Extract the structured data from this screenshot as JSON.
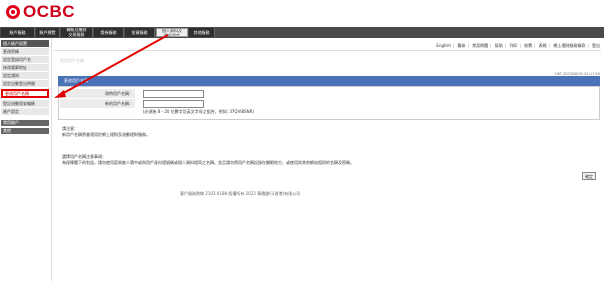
{
  "brand": {
    "name": "OCBC",
    "color": "#e3001b"
  },
  "topnav": {
    "tabs": [
      {
        "label": "賬戶服務",
        "lines": 1
      },
      {
        "label": "賬戶總覽",
        "lines": 1
      },
      {
        "label": "轉賬及繳款\n交易服務",
        "lines": 2
      },
      {
        "label": "證券服務",
        "lines": 1
      },
      {
        "label": "投資服務",
        "lines": 1
      },
      {
        "label": "個人資料及\n賬戶設定",
        "lines": 2,
        "active": true
      },
      {
        "label": "其他服務",
        "lines": 1
      }
    ]
  },
  "sidebar": {
    "items": [
      {
        "label": "個人賬戶設置",
        "style": "head"
      },
      {
        "label": "更改密碼",
        "style": "normal"
      },
      {
        "label": "設定登錄用戶名",
        "style": "normal"
      },
      {
        "label": "修改電郵地址",
        "style": "normal"
      },
      {
        "label": "設定通知",
        "style": "normal"
      },
      {
        "label": "設定自動登出時間",
        "style": "normal"
      },
      {
        "label": "更改用戶名稱",
        "style": "highlight"
      },
      {
        "label": "登記流動保安編碼",
        "style": "normal"
      },
      {
        "label": "賬戶設定",
        "style": "normal"
      },
      {
        "label": "常用賬戶",
        "style": "dark"
      },
      {
        "label": "其他",
        "style": "dark"
      }
    ]
  },
  "utility_links": [
    "English",
    "簡体",
    "常見問題",
    "幫助",
    "列印",
    "收費",
    "表格",
    "網上理財服務條款",
    "登出"
  ],
  "page_title": "更改用戶名稱",
  "timestamp": "HKT 2023/08/31 01:17:55",
  "form": {
    "header": "更改用戶名稱",
    "old_label": "現時用戶名稱：",
    "old_value": "",
    "new_label": "新的用戶名稱：",
    "new_value": "",
    "hint": "(必須為 8 - 20 位數字及英文字母之組合，例如: 37QVI8SNR)"
  },
  "notes": {
    "title": "請注意：",
    "text": "新用戶名稱將會適用於網上理財及流動理財服務。",
    "tip_title": "選擇用戶名稱注意事項：",
    "tip_text": "為保障閣下的利益，請勿使用容易被人猜中或與用戶身份證號碼或個人資料相同之名稱。並且請勿將用戶名稱記錄在顯眼地方，或使用與其他網站相同的名稱及密碼。"
  },
  "confirm_label": "確定",
  "footer": "客戶服務熱線 2103-0188     版權所有 2023 華僑銀行(香港)有限公司"
}
